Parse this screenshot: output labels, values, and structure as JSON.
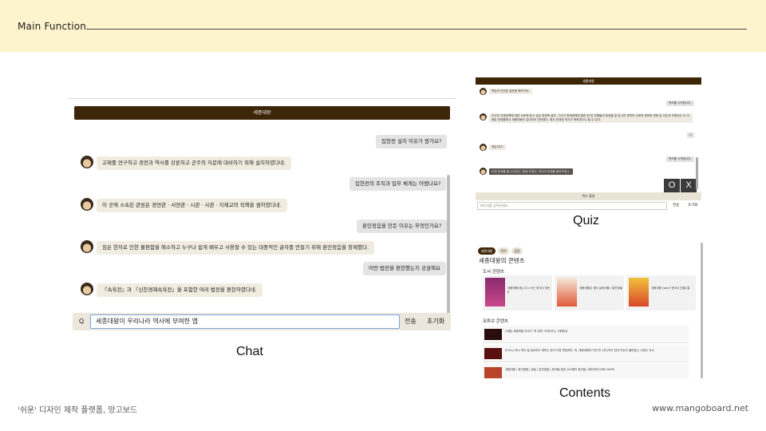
{
  "header": {
    "title": "Main Function"
  },
  "chat": {
    "title": "세종대왕",
    "messages": [
      {
        "role": "user",
        "text": "집현전 설치 이유가 뭔가요?"
      },
      {
        "role": "bot",
        "text": "고제를 연구하고 경전과 역사를 강론하고 군주의 자문에 대비하기 위해 설치하였다네."
      },
      {
        "role": "user",
        "text": "집현전의 조직과 업무 체계는 어땠나요?"
      },
      {
        "role": "bot",
        "text": "이 곳에 소속된 관원은 경연관 · 서연관 · 시관 · 사관 · 지제교의 직책을 겸하였다네."
      },
      {
        "role": "user",
        "text": "훈민정음을 만든 이유는 무엇인가요?"
      },
      {
        "role": "bot",
        "text": "짐은 한자로 인한 불편함을 해소하고 누구나 쉽게 배우고 사용할 수 있는 대중적인 글자를 만들기 위해 훈민정음을 창제했다."
      },
      {
        "role": "user",
        "text": "어떤 법전을 편찬했는지 궁금해요"
      },
      {
        "role": "bot",
        "text": "『속육전』과 『신찬경제속육전』을 포함한 여러 법전을 편찬하였다네."
      }
    ],
    "q_label": "Q",
    "input_value": "세종대왕이 우리나라 역사에 부여한 엠",
    "send_label": "전송",
    "reset_label": "초기화",
    "caption": "Chat"
  },
  "quiz": {
    "title": "세종대왕",
    "lines": [
      "학습과 관련된 질문을 해보거라.",
      "퀴즈를 시작합니다.",
      "조선의 국경정책에 대한 소문에 듣고 싶은 위정책 설치. 그리고 총제정책에 통한 한 번 전해들의 특징을 잘 당시의 영역의 사회적 문화와 변화 된 어진과 조화되는 이 이폐된 반제품에서 세종대왕이 유리되어 천하였다. 에서 반대한 역사가 택하였으니 될 수 있다.",
      "O",
      "정답이다!",
      "퀴즈를 시작합니다.",
      "이제 문제를 풀 시간이다. 함께 보겠다. 역사의 문제를 풀어보게나."
    ],
    "o_label": "O",
    "x_label": "X",
    "submit_label": "퀴즈 풀셜",
    "input_placeholder": "메시지를 입력하세요",
    "send_label": "전송",
    "reset_label": "초기화",
    "caption": "Quiz"
  },
  "contents": {
    "tabs": [
      "세종대왕",
      "퀴즈",
      "검증"
    ],
    "title": "세종대왕의 콘텐츠",
    "books_heading": "도서 콘텐츠",
    "books": [
      {
        "title": "세종대왕(재)/ 다시 쓰는 한국사 위인 8",
        "meta": "저자 · 출판사"
      },
      {
        "title": "세종대왕은 생각 삶에서를 / 통인정을",
        "meta": "저자 · 출판사"
      },
      {
        "title": "세종대왕 (why? 한국사 인물) 통",
        "meta": "저자 · 출판사"
      }
    ],
    "youtube_heading": "유튜브 콘텐츠",
    "videos": [
      {
        "title": "[세종] 세종대왕 이야기 ‘측 업적’ 오래가다 | 사회특강",
        "meta": "채널명 · 조회수"
      },
      {
        "title": "[FULL] 하나 하다 설 집요하고 재미는 한국 이정 편집하여, 외, 세종대왕과 이전 번 1편 [역사 반전 어읽고 플러튼] | 신정두 교수",
        "meta": "채널명 · 조회수"
      },
      {
        "title": "세종대왕 | 위인탐험 | 한글 | 훈민정음 | 한국을 빛낸 100명의 위인들 | 해어이어 KIDS HAYR",
        "meta": "채널명 · 조회수"
      }
    ],
    "caption": "Contents"
  },
  "footer": {
    "left": "'쉬운' 디자인 제작 플랫폼, 망고보드",
    "right": "www.mangoboard.net"
  },
  "colors": {
    "accent_brown": "#3d2508",
    "header_band": "#fdf3cc"
  }
}
